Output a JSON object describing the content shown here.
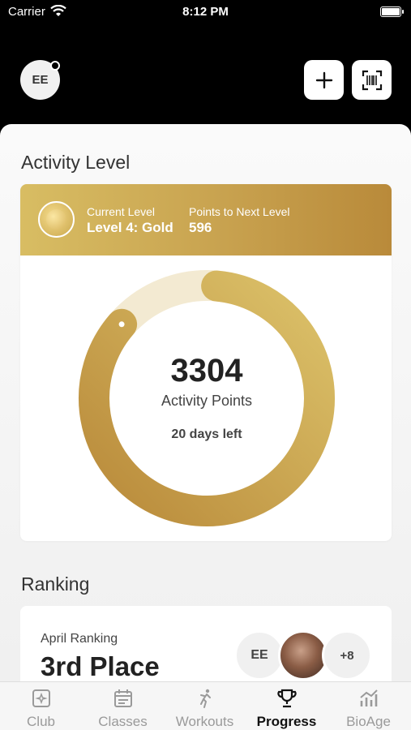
{
  "status_bar": {
    "carrier": "Carrier",
    "time": "8:12 PM"
  },
  "header": {
    "avatar_initials": "EE",
    "add_icon": "plus-icon",
    "scan_icon": "barcode-scan-icon"
  },
  "activity": {
    "section_title": "Activity Level",
    "current_level_label": "Current Level",
    "current_level_value": "Level 4: Gold",
    "points_next_label": "Points to Next Level",
    "points_next_value": "596",
    "points_value": "3304",
    "points_label": "Activity Points",
    "days_left": "20 days left",
    "progress_fraction": 0.85,
    "colors": {
      "gold_light": "#d8bd63",
      "gold_dark": "#b98a3a",
      "track": "#f3ead2"
    }
  },
  "ranking": {
    "section_title": "Ranking",
    "label": "April Ranking",
    "value": "3rd Place",
    "avatar_initials": "EE",
    "more_count": "+8"
  },
  "tabs": [
    {
      "label": "Club",
      "icon": "club-icon",
      "active": false
    },
    {
      "label": "Classes",
      "icon": "calendar-icon",
      "active": false
    },
    {
      "label": "Workouts",
      "icon": "workout-icon",
      "active": false
    },
    {
      "label": "Progress",
      "icon": "trophy-icon",
      "active": true
    },
    {
      "label": "BioAge",
      "icon": "chart-icon",
      "active": false
    }
  ]
}
